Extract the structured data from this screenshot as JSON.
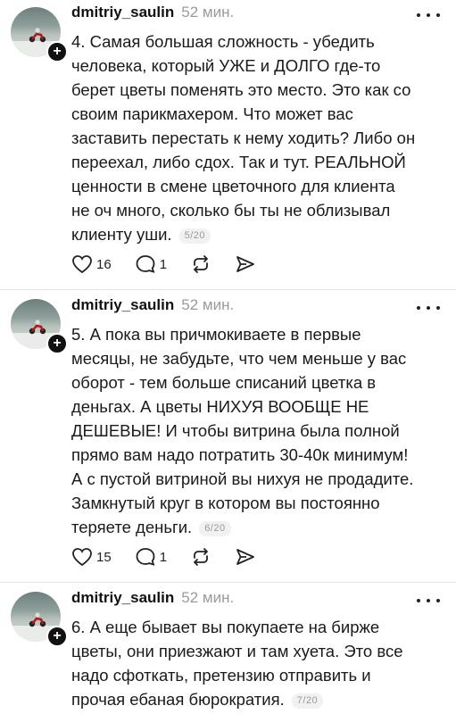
{
  "posts": [
    {
      "username": "dmitriy_saulin",
      "time": "52 мин.",
      "text": "4. Самая большая сложность - убедить\nчеловека, который УЖЕ и ДОЛГО где-то\nберет цветы поменять это место. Это как со\nсвоим парикмахером. Что может вас\nзаставить перестать к нему ходить? Либо он\nпереехал, либо сдох. Так и тут. РЕАЛЬНОЙ\nценности в смене цветочного для клиента\nне оч много, сколько бы ты не облизывал\nклиенту уши.",
      "page": "5/20",
      "likes": "16",
      "replies": "1"
    },
    {
      "username": "dmitriy_saulin",
      "time": "52 мин.",
      "text": "5. А пока вы причмокиваете в первые\nмесяцы, не забудьте, что чем меньше у вас\nоборот - тем больше списаний цветка в\nденьгах. А цветы НИХУЯ ВООБЩЕ НЕ\nДЕШЕВЫЕ! И чтобы витрина была полной\nпрямо вам надо потратить 30-40к минимум!\nА с пустой витриной вы нихуя не продадите.\nЗамкнутый круг в котором вы постоянно\nтеряете деньги.",
      "page": "6/20",
      "likes": "15",
      "replies": "1"
    },
    {
      "username": "dmitriy_saulin",
      "time": "52 мин.",
      "text": "6. А еще бывает вы покупаете на бирже\nцветы, они приезжают и там хуета. Это все\nнадо сфоткать, претензию отправить и\nпрочая ебаная бюрократия.",
      "page": "7/20"
    }
  ],
  "icons": {
    "like": "heart-icon",
    "reply": "comment-icon",
    "repost": "repost-icon",
    "share": "send-icon",
    "more": "more-icon",
    "follow": "plus-icon"
  }
}
